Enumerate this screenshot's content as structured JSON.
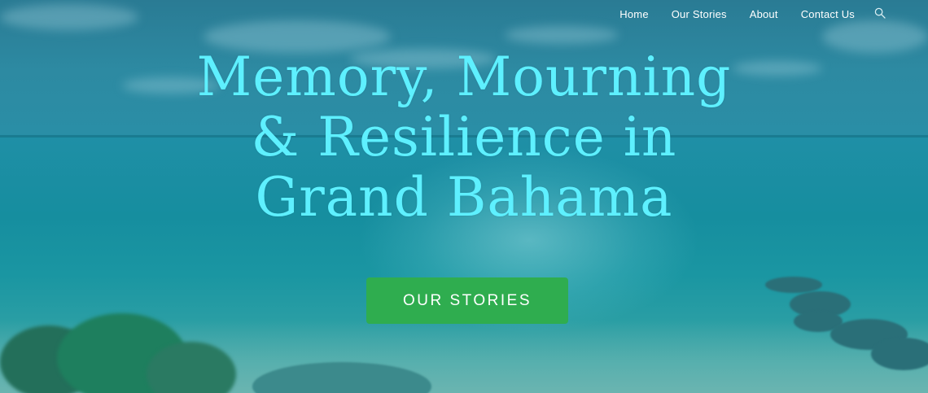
{
  "nav": {
    "items": [
      "Home",
      "Our Stories",
      "About",
      "Contact Us"
    ],
    "search_icon": "search-icon"
  },
  "hero": {
    "title_lines": [
      "Memory, Mourning",
      "& Resilience in",
      "Grand Bahama"
    ],
    "cta_label": "OUR STORIES"
  },
  "colors": {
    "title": "#5ef0ff",
    "cta_background": "#2fad4f",
    "overlay": "#1a8ea3"
  }
}
